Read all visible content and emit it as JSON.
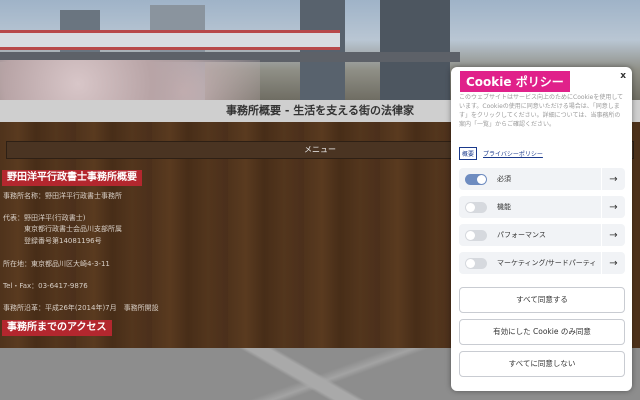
{
  "page": {
    "title": "事務所概要 - 生活を支える街の法律家",
    "menu_label": "メニュー"
  },
  "office": {
    "heading": "野田洋平行政書士事務所概要",
    "name_line": "事務所名称：野田洋平行政書士事務所",
    "rep_line1": "代表：野田洋平(行政書士)",
    "rep_line2": "東京都行政書士会品川支部所属",
    "rep_line3": "登録番号第14081196号",
    "address_line": "所在地：東京都品川区大崎4-3-11",
    "tel_line": "Tel・Fax：03-6417-9876",
    "history_line": "事務所沿革：平成26年(2014年)7月　事務所開設",
    "access_heading": "事務所までのアクセス"
  },
  "cookie": {
    "title": "Cookie ポリシー",
    "close": "x",
    "description": "このウェブサイトはサービス向上のためにCookieを使用しています。Cookieの使用に同意いただける場合は、「同意します」をクリックしてください。詳細については、当事務所の案内「一覧」からご確認ください。",
    "summary_link": "概要",
    "privacy_link": "プライバシーポリシー",
    "categories": [
      {
        "label": "必須",
        "enabled": true
      },
      {
        "label": "機能",
        "enabled": false
      },
      {
        "label": "パフォーマンス",
        "enabled": false
      },
      {
        "label": "マーケティング/サードパーティ",
        "enabled": false
      }
    ],
    "arrow": "→",
    "accept_all": "すべて同意する",
    "accept_selected": "有効にした Cookie のみ同意",
    "reject_all": "すべてに同意しない"
  }
}
